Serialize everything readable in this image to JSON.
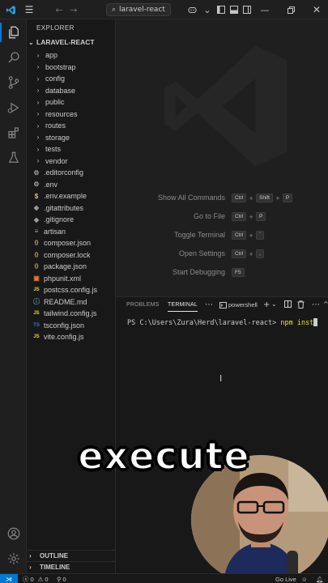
{
  "titlebar": {
    "search_text": "laravel-react"
  },
  "sidebar": {
    "title": "EXPLORER",
    "project": "LARAVEL-REACT",
    "folders": [
      "app",
      "bootstrap",
      "config",
      "database",
      "public",
      "resources",
      "routes",
      "storage",
      "tests",
      "vendor"
    ],
    "files": [
      {
        "name": ".editorconfig",
        "icon": "gear-icon",
        "glyph": "⚙",
        "color": "#9d9d9d"
      },
      {
        "name": ".env",
        "icon": "gear-icon",
        "glyph": "⚙",
        "color": "#9d9d9d"
      },
      {
        "name": ".env.example",
        "icon": "dollar-icon",
        "glyph": "$",
        "color": "#e2c08d"
      },
      {
        "name": ".gitattributes",
        "icon": "git-icon",
        "glyph": "◆",
        "color": "#9d9d9d"
      },
      {
        "name": ".gitignore",
        "icon": "git-icon",
        "glyph": "◆",
        "color": "#9d9d9d"
      },
      {
        "name": "artisan",
        "icon": "file-icon",
        "glyph": "≡",
        "color": "#9d9d9d"
      },
      {
        "name": "composer.json",
        "icon": "json-icon",
        "glyph": "{}",
        "color": "#e5c07b"
      },
      {
        "name": "composer.lock",
        "icon": "json-icon",
        "glyph": "{}",
        "color": "#e5c07b"
      },
      {
        "name": "package.json",
        "icon": "json-icon",
        "glyph": "{}",
        "color": "#e5c07b"
      },
      {
        "name": "phpunit.xml",
        "icon": "xml-icon",
        "glyph": "▣",
        "color": "#e37933"
      },
      {
        "name": "postcss.config.js",
        "icon": "js-icon",
        "glyph": "JS",
        "color": "#e8d44d"
      },
      {
        "name": "README.md",
        "icon": "info-icon",
        "glyph": "ⓘ",
        "color": "#519aba"
      },
      {
        "name": "tailwind.config.js",
        "icon": "js-icon",
        "glyph": "JS",
        "color": "#e8d44d"
      },
      {
        "name": "tsconfig.json",
        "icon": "ts-icon",
        "glyph": "TS",
        "color": "#3178c6"
      },
      {
        "name": "vite.config.js",
        "icon": "js-icon",
        "glyph": "JS",
        "color": "#e8d44d"
      }
    ],
    "outline": "OUTLINE",
    "timeline": "TIMELINE"
  },
  "editor": {
    "shortcuts": [
      {
        "label": "Show All Commands",
        "keys": [
          "Ctrl",
          "Shift",
          "P"
        ]
      },
      {
        "label": "Go to File",
        "keys": [
          "Ctrl",
          "P"
        ]
      },
      {
        "label": "Toggle Terminal",
        "keys": [
          "Ctrl",
          "`"
        ]
      },
      {
        "label": "Open Settings",
        "keys": [
          "Ctrl",
          ","
        ]
      },
      {
        "label": "Start Debugging",
        "keys": [
          "F5"
        ]
      }
    ]
  },
  "panel": {
    "tab_problems": "PROBLEMS",
    "tab_terminal": "TERMINAL",
    "shell": "powershell",
    "prompt": "PS C:\\Users\\Zura\\Herd\\laravel-react> ",
    "command": "npm inst"
  },
  "statusbar": {
    "errors": "0",
    "warnings": "0",
    "ports": "0",
    "live": "Go Live"
  },
  "caption": "execute",
  "colors": {
    "accent": "#0078d4",
    "terminal_command": "#e5e510"
  }
}
